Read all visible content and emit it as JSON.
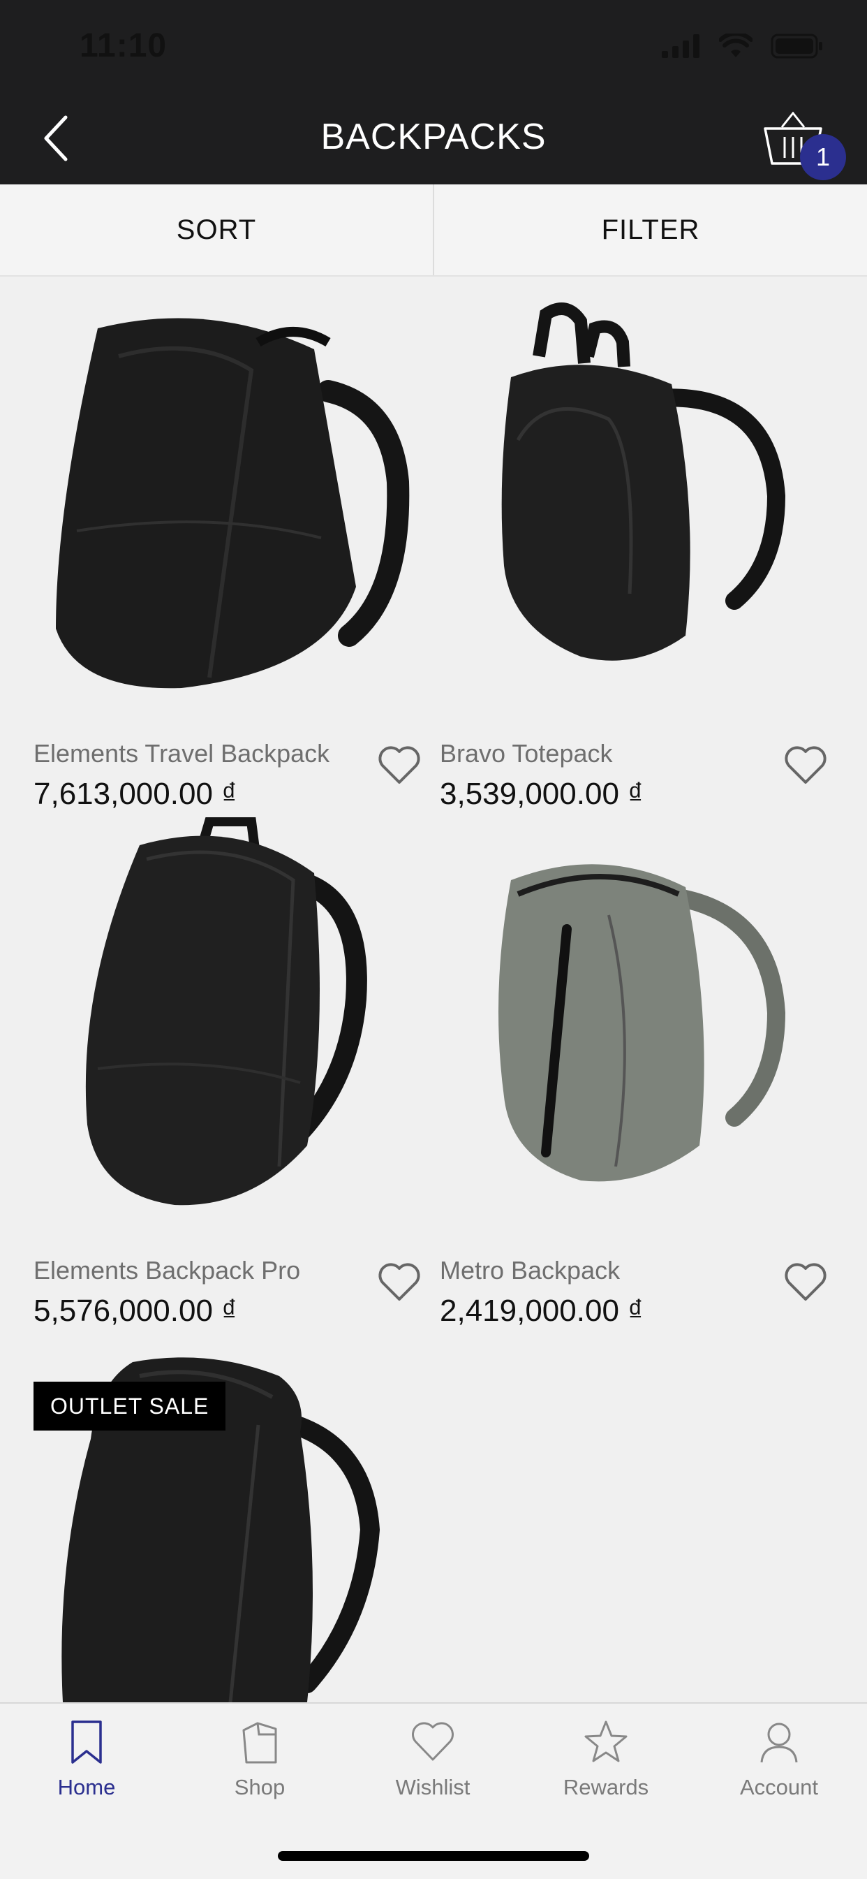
{
  "status_bar": {
    "time": "11:10"
  },
  "header": {
    "title": "BACKPACKS",
    "cart_count": "1"
  },
  "toolbar": {
    "sort_label": "SORT",
    "filter_label": "FILTER"
  },
  "products": [
    {
      "name": "Elements Travel Backpack",
      "price": "7,613,000.00 ₫",
      "color": "#1c1c1c"
    },
    {
      "name": "Bravo Totepack",
      "price": "3,539,000.00 ₫",
      "color": "#1f1f1f"
    },
    {
      "name": "Elements Backpack Pro",
      "price": "5,576,000.00 ₫",
      "color": "#202020"
    },
    {
      "name": "Metro Backpack",
      "price": "2,419,000.00 ₫",
      "color": "#7d837b"
    }
  ],
  "outlet_badge": "OUTLET SALE",
  "bottom_nav": [
    {
      "label": "Home",
      "icon": "bookmark-icon",
      "active": true
    },
    {
      "label": "Shop",
      "icon": "shopping-bag-icon"
    },
    {
      "label": "Wishlist",
      "icon": "heart-icon"
    },
    {
      "label": "Rewards",
      "icon": "star-icon"
    },
    {
      "label": "Account",
      "icon": "user-icon"
    }
  ],
  "colors": {
    "accent": "#2b2f8f",
    "header_bg": "#1e1e1f",
    "page_bg": "#f0f0f0"
  }
}
